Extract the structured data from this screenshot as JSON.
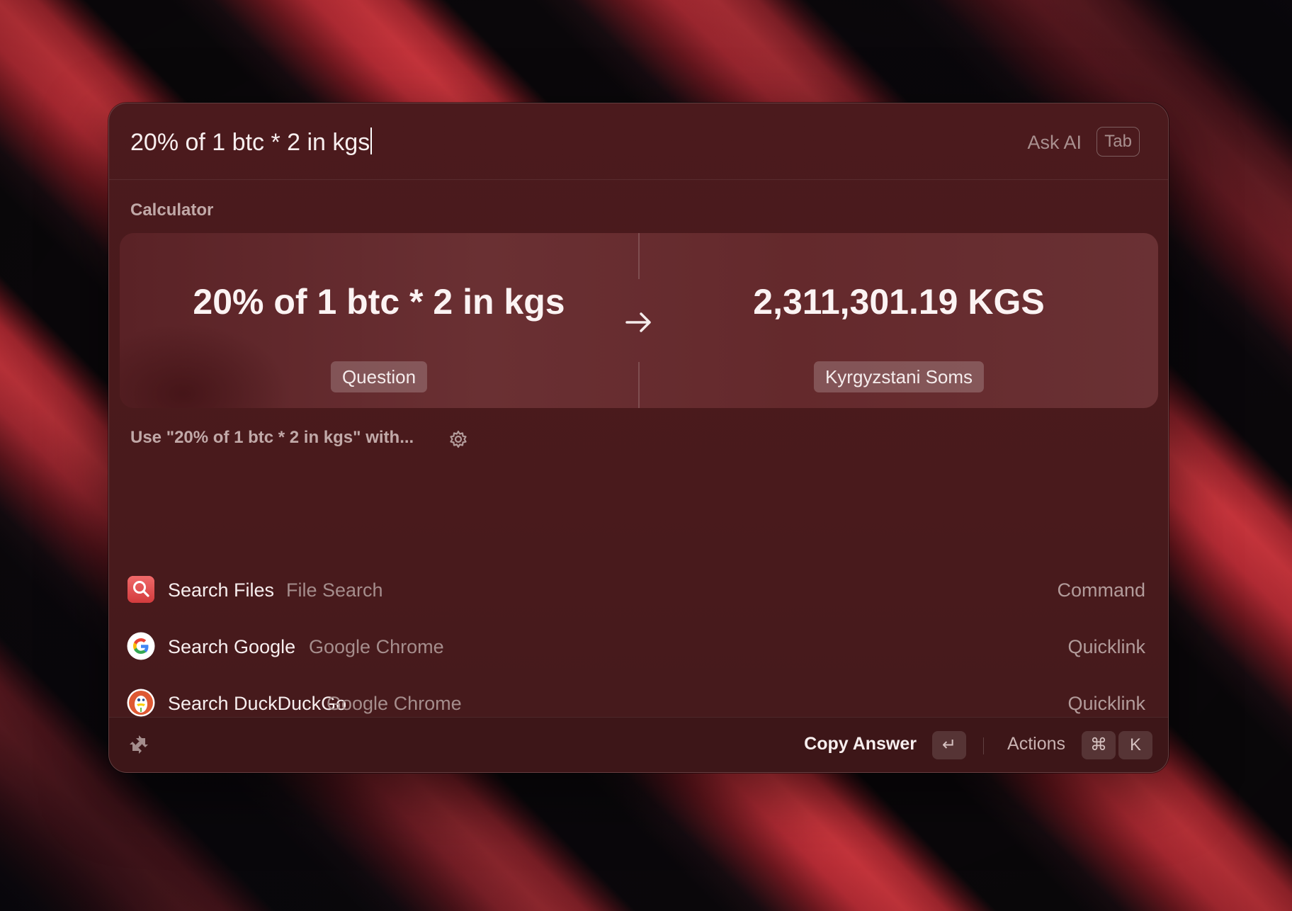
{
  "search": {
    "query": "20% of 1 btc * 2 in kgs",
    "ask_ai_label": "Ask AI",
    "ask_ai_key": "Tab"
  },
  "calculator": {
    "section_label": "Calculator",
    "question": "20% of 1 btc * 2 in kgs",
    "question_tag": "Question",
    "answer": "2,311,301.19 KGS",
    "answer_tag": "Kyrgyzstani Soms",
    "arrow_icon": "arrow-right-icon"
  },
  "use_with": {
    "label": "Use \"20% of 1 btc * 2 in kgs\" with...",
    "settings_icon": "gear-icon"
  },
  "results": [
    {
      "title": "Search Files",
      "subtitle": "File Search",
      "kind": "Command",
      "icon": "file-search-icon"
    },
    {
      "title": "Search Google",
      "subtitle": "Google Chrome",
      "kind": "Quicklink",
      "icon": "google-icon"
    },
    {
      "title": "Search DuckDuckGo",
      "subtitle": "Google Chrome",
      "kind": "Quicklink",
      "icon": "duckduckgo-icon"
    }
  ],
  "footer": {
    "primary_action": "Copy Answer",
    "primary_key": "↵",
    "actions_label": "Actions",
    "actions_keys": [
      "⌘",
      "K"
    ]
  },
  "colors": {
    "accent": "#e24b4b",
    "window_bg": "#4b1a1d",
    "card_bg": "#6a3033"
  }
}
